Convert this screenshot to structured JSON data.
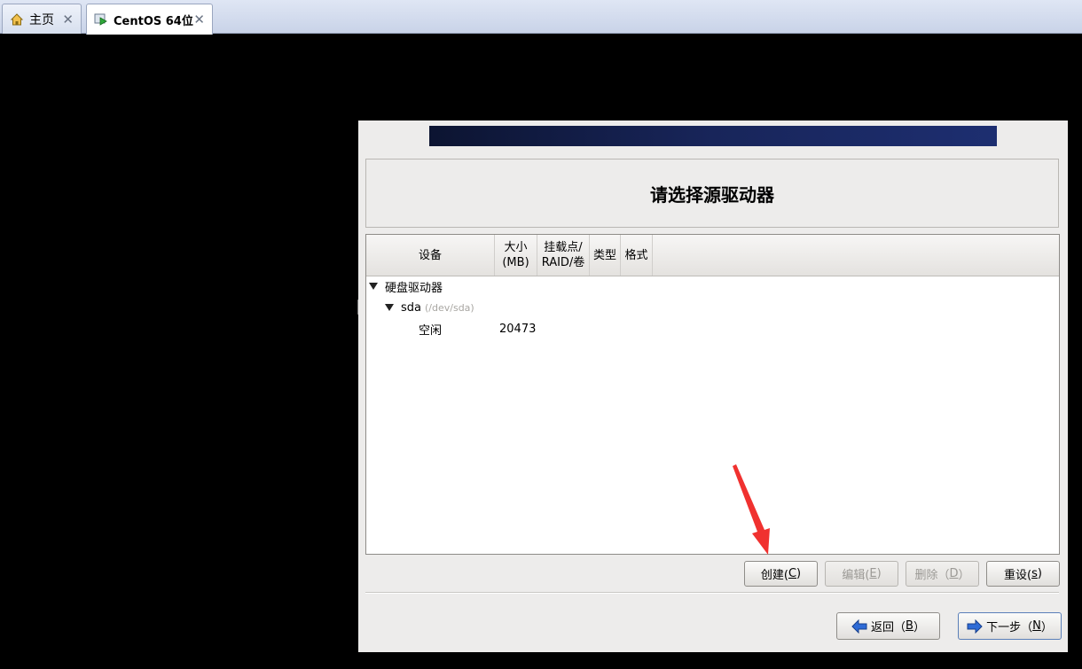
{
  "tabs": [
    {
      "label": "主页",
      "icon": "home-icon"
    },
    {
      "label": "CentOS 64位",
      "icon": "vm-play-icon"
    }
  ],
  "dialog": {
    "title": "请选择源驱动器"
  },
  "table": {
    "columns": {
      "device": "设备",
      "size_line1": "大小",
      "size_line2": "(MB)",
      "mount_line1": "挂载点/",
      "mount_line2": "RAID/卷",
      "type": "类型",
      "format": "格式"
    },
    "rows": {
      "group": "硬盘驱动器",
      "disk_name": "sda",
      "disk_path": "(/dev/sda)",
      "free_label": "空闲",
      "free_size": "20473"
    }
  },
  "buttons": {
    "create_text": "创建(",
    "create_key": "C",
    "create_end": ")",
    "edit_text": "编辑(",
    "edit_key": "E",
    "edit_end": ")",
    "delete_text": "删除（",
    "delete_key": "D",
    "delete_end": "）",
    "reset_text": "重设(",
    "reset_key": "s",
    "reset_end": ")",
    "back_text": "返回（",
    "back_key": "B",
    "back_end": "）",
    "next_text": "下一步（",
    "next_key": "N",
    "next_end": "）"
  },
  "colors": {
    "annotation_arrow": "#f0312f",
    "nav_arrow": "#2e6bd6"
  }
}
